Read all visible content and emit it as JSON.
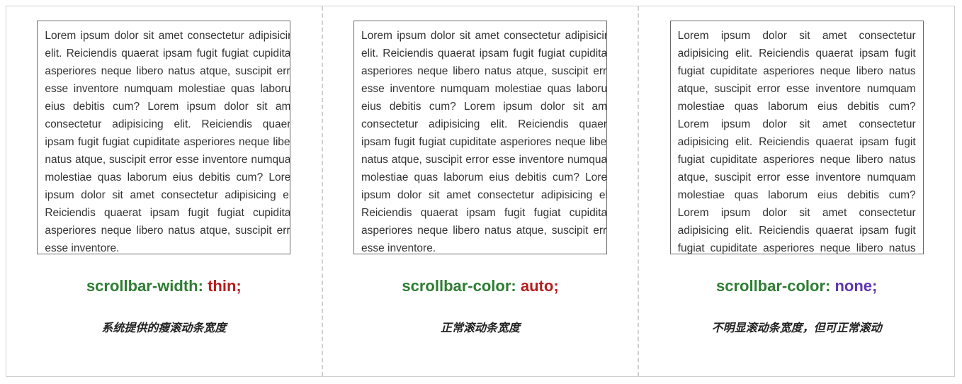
{
  "lorem": "Lorem ipsum dolor sit amet consectetur adipisicing elit. Reiciendis quaerat ipsam fugit fugiat cupiditate asperiores neque libero natus atque, suscipit error esse inventore numquam molestiae quas laborum eius debitis cum? Lorem ipsum dolor sit amet consectetur adipisicing elit. Reiciendis quaerat ipsam fugit fugiat cupiditate asperiores neque libero natus atque, suscipit error esse inventore numquam molestiae quas laborum eius debitis cum? Lorem ipsum dolor sit amet consectetur adipisicing elit. Reiciendis quaerat ipsam fugit fugiat cupiditate asperiores neque libero natus atque, suscipit error esse inventore.",
  "panels": [
    {
      "prop": "scrollbar-width",
      "value": "thin;",
      "value_color": "red",
      "desc": "系统提供的瘦滚动条宽度",
      "scroll": "thin"
    },
    {
      "prop": "scrollbar-color",
      "value": "auto;",
      "value_color": "red",
      "desc": "正常滚动条宽度",
      "scroll": "auto"
    },
    {
      "prop": "scrollbar-color",
      "value": "none;",
      "value_color": "purple",
      "desc": "不明显滚动条宽度，但可正常滚动",
      "scroll": "none"
    }
  ]
}
